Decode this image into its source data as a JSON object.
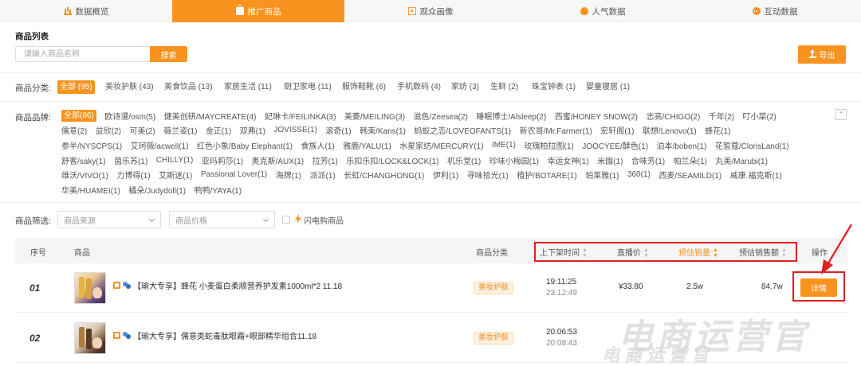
{
  "tabs": [
    {
      "label": "数据概览",
      "icon": "bar-chart-icon",
      "active": false
    },
    {
      "label": "推广商品",
      "icon": "shopping-bag-icon",
      "active": true
    },
    {
      "label": "观众画像",
      "icon": "face-scan-icon",
      "active": false
    },
    {
      "label": "人气数据",
      "icon": "fire-icon",
      "active": false
    },
    {
      "label": "互动数据",
      "icon": "chat-icon",
      "active": false
    }
  ],
  "section_title": "商品列表",
  "search": {
    "placeholder": "请输入商品名称",
    "value": "",
    "button_label": "搜索"
  },
  "export_label": "导出",
  "category": {
    "label": "商品分类:",
    "items": [
      "全部 (95)",
      "美妆护肤 (43)",
      "美食饮品 (13)",
      "家居生活 (11)",
      "厨卫家电 (11)",
      "服饰鞋靴 (6)",
      "手机数码 (4)",
      "家纺 (3)",
      "生鲜 (2)",
      "珠宝钟表 (1)",
      "婴童寝居 (1)"
    ]
  },
  "brand": {
    "label": "商品品牌:",
    "lines": [
      [
        "全部(86)",
        "欧诗漫/osm(5)",
        "健美创研/MAYCREATE(4)",
        "妃琳卡/FEILINKA(3)",
        "美菱/MEILING(3)",
        "滋色/Zeesea(2)",
        "睡眠博士/Alsleep(2)",
        "西蜜/HONEY SNOW(2)",
        "志高/CHIGO(2)",
        "千年(2)",
        "叮小菜(2)"
      ],
      [
        "儒意(2)",
        "益欣(2)",
        "可美(2)",
        "薇兰姿(1)",
        "金正(1)",
        "双弗(1)",
        "JOVISSE(1)",
        "滚奇(1)",
        "韩束/Kans(1)",
        "蚂蚁之恋/LOVEOFANTS(1)",
        "新农哥/Mr.Farmer(1)",
        "宏轩阁(1)",
        "联想/Lenovo(1)",
        "蜂花(1)"
      ],
      [
        "参半/NYSCPS(1)",
        "艾珂薇/acwell(1)",
        "红色小象/Baby Elephant(1)",
        "食族人(1)",
        "雅鹿/YALU(1)",
        "水星家纺/MERCURY(1)",
        "IME(1)",
        "玫瑰柏拉图(1)",
        "JOOCYEE/酵色(1)",
        "泊本/boben(1)",
        "花皙蔻/ClorisLand(1)"
      ],
      [
        "舒客/saky(1)",
        "茵乐苏(1)",
        "CHILLY(1)",
        "亚玛莉莎(1)",
        "奥克斯/AUX(1)",
        "拉芳(1)",
        "乐扣乐扣/LOCK&LOCK(1)",
        "机乐堂(1)",
        "珍味小梅园(1)",
        "幸运女神(1)",
        "米囤(1)",
        "合味芳(1)",
        "帕兰朵(1)",
        "丸美/Marubi(1)"
      ],
      [
        "维沃/VIVO(1)",
        "力博得(1)",
        "艾斯迷(1)",
        "Passional Lover(1)",
        "海牌(1)",
        "派派(1)",
        "长虹/CHANGHONG(1)",
        "伊利(1)",
        "寻味拾光(1)",
        "植护/BOTARE(1)",
        "珀莱雅(1)",
        "360(1)",
        "西麦/SEAMILD(1)",
        "威康.福克斯(1)"
      ],
      [
        "华美/HUAMEI(1)",
        "橘朵/Judydoll(1)",
        "鸭鸭/YAYA(1)"
      ]
    ]
  },
  "filter": {
    "label": "商品筛选:",
    "source_placeholder": "商品来源",
    "price_placeholder": "商品价格",
    "flash_label": "闪电购商品"
  },
  "table": {
    "headers": {
      "index": "序号",
      "product": "商品",
      "category": "商品分类",
      "time": "上下架时间",
      "price": "直播价",
      "est_sales": "预估销量",
      "est_revenue": "预估销售额",
      "action": "操作"
    },
    "rows": [
      {
        "index": "01",
        "name": "【瑜大专享】蜂花 小麦蛋白柔顺营养护发素1000ml*2 11.18",
        "category": "美妆护肤",
        "time_on": "19:11:25",
        "time_off": "23:12:49",
        "price": "¥33.80",
        "sales": "2.5w",
        "revenue": "84.7w",
        "action": "详情"
      },
      {
        "index": "02",
        "name": "【瑜大专享】儒意类蛇毒肽眼霜+眼部精华组合11.18",
        "category": "美妆护肤",
        "time_on": "20:06:53",
        "time_off": "20:08:43",
        "price": "",
        "sales": "",
        "revenue": "",
        "action": ""
      }
    ]
  },
  "watermark": {
    "main": "电商运营官",
    "sub": "电商运营官"
  },
  "colors": {
    "accent": "#f7931e",
    "annotation_red": "#e02020"
  }
}
